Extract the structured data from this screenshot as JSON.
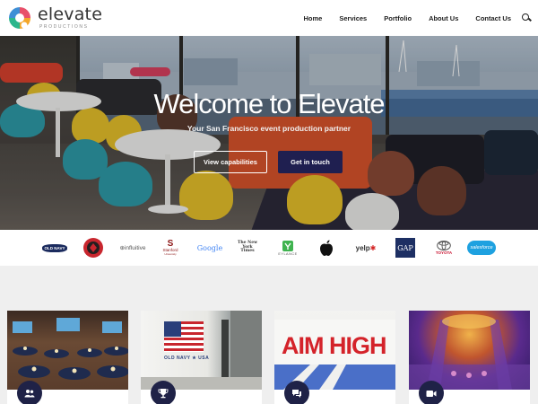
{
  "brand": {
    "name": "elevate",
    "tagline": "PRODUCTIONS",
    "accent": "#1f1f50"
  },
  "nav": {
    "items": [
      "Home",
      "Services",
      "Portfolio",
      "About Us",
      "Contact Us"
    ],
    "search_icon": "search-icon"
  },
  "hero": {
    "title": "Welcome to Elevate",
    "subtitle": "Your San Francisco event production partner",
    "primary_button": "View capabilities",
    "secondary_button": "Get in touch"
  },
  "clients": [
    {
      "name": "OLD NAVY"
    },
    {
      "name": "club-emblem"
    },
    {
      "name": "influitive"
    },
    {
      "name": "Stanford",
      "sub": "University"
    },
    {
      "name": "Google"
    },
    {
      "name": "The New York Times"
    },
    {
      "name": "EYLANCE"
    },
    {
      "name": "apple-logo"
    },
    {
      "name": "yelp"
    },
    {
      "name": "GAP"
    },
    {
      "name": "TOYOTA"
    },
    {
      "name": "salesforce"
    }
  ],
  "cards": [
    {
      "badge_icon": "people-icon",
      "image_text": ""
    },
    {
      "badge_icon": "trophy-icon",
      "image_text": "OLD NAVY ★ USA"
    },
    {
      "badge_icon": "chat-icon",
      "image_text": "AIM HIGH"
    },
    {
      "badge_icon": "video-icon",
      "image_text": ""
    }
  ]
}
